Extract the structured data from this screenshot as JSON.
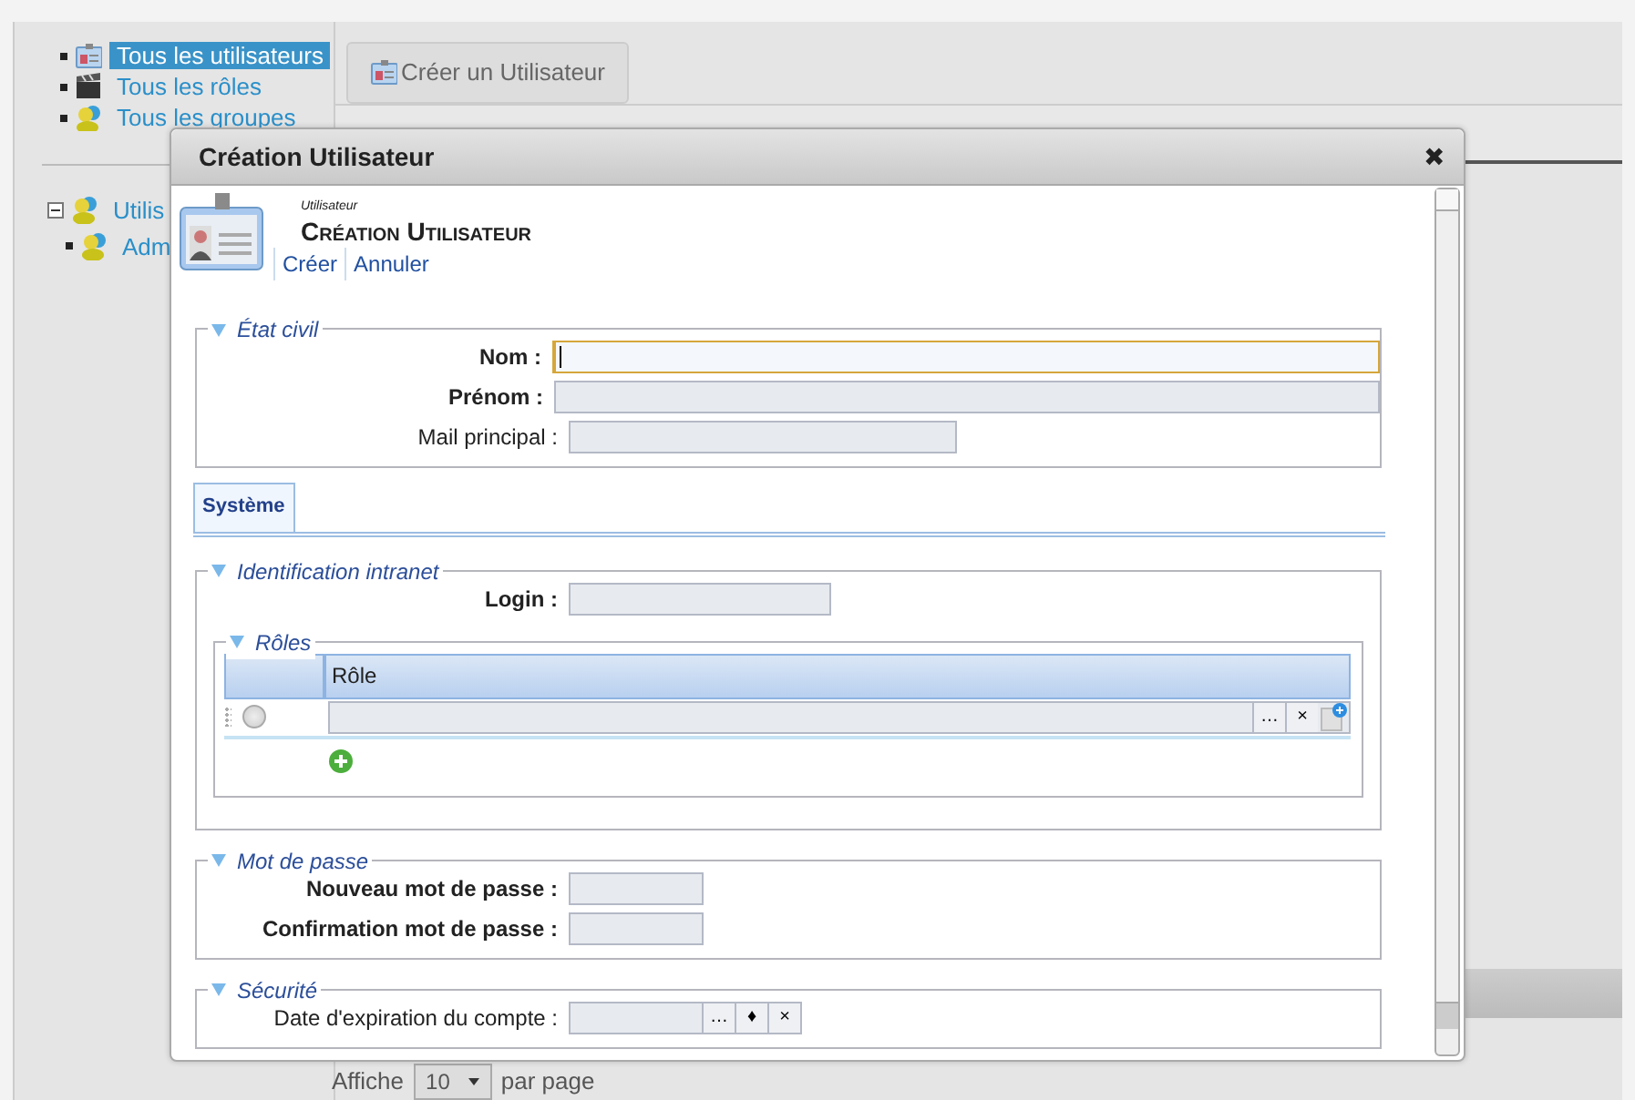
{
  "sidebar": {
    "items": [
      {
        "label": "Tous les utilisateurs",
        "selected": true
      },
      {
        "label": "Tous les rôles",
        "selected": false
      },
      {
        "label": "Tous les groupes",
        "selected": false
      }
    ]
  },
  "tree": [
    {
      "label": "Utilis",
      "expanded": true,
      "children": [
        {
          "label": "Adm"
        }
      ]
    }
  ],
  "toolbar": {
    "create_button": "Créer un Utilisateur"
  },
  "pager": {
    "prefix": "Affiche",
    "page_size": "10",
    "suffix": "par page"
  },
  "dialog": {
    "title": "Création Utilisateur",
    "close": "✖",
    "subtitle": "Utilisateur",
    "heading": "Création Utilisateur",
    "actions": [
      "Créer",
      "Annuler"
    ],
    "civil": {
      "legend": "État civil",
      "fields": [
        {
          "label": "Nom :",
          "required": true,
          "focused": true,
          "kind": "wide"
        },
        {
          "label": "Prénom :",
          "required": true,
          "focused": false,
          "kind": "wide"
        },
        {
          "label": "Mail principal :",
          "required": false,
          "focused": false,
          "kind": "medium"
        }
      ]
    },
    "tabs": [
      {
        "label": "Système",
        "selected": true
      }
    ],
    "sections": [
      {
        "legend": "Identification intranet",
        "fields": [
          {
            "label": "Login :",
            "required": true,
            "focused": false,
            "kind": "narrow"
          }
        ],
        "roles": {
          "legend": "Rôles",
          "columns": [
            "",
            "Rôle"
          ],
          "rows": [
            {
              "selected": false,
              "buttons": [
                "…",
                "×"
              ]
            }
          ]
        }
      },
      {
        "legend": "Mot de passe",
        "fields": [
          {
            "label": "Nouveau mot de passe :",
            "required": true,
            "focused": false,
            "kind": "short"
          },
          {
            "label": "Confirmation mot de passe :",
            "required": true,
            "focused": false,
            "kind": "short"
          }
        ]
      },
      {
        "legend": "Sécurité",
        "fields": [
          {
            "label": "Date d'expiration du compte :",
            "required": false,
            "focused": false,
            "kind": "short",
            "buttons": [
              "…",
              "♦",
              "×"
            ]
          }
        ]
      }
    ]
  }
}
